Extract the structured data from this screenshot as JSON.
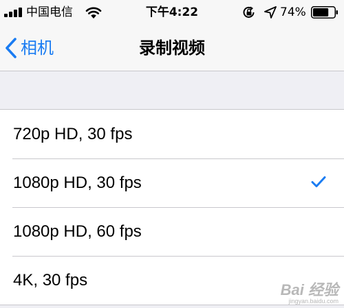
{
  "status_bar": {
    "carrier": "中国电信",
    "time": "下午4:22",
    "battery_percent": "74%",
    "battery_level": 0.74,
    "icons": [
      "signal-bars-icon",
      "wifi-icon",
      "rotation-lock-icon",
      "location-arrow-icon",
      "battery-icon"
    ]
  },
  "nav": {
    "back_label": "相机",
    "title": "录制视频"
  },
  "options": [
    {
      "label": "720p HD, 30 fps",
      "selected": false
    },
    {
      "label": "1080p HD, 30 fps",
      "selected": true
    },
    {
      "label": "1080p HD, 60 fps",
      "selected": false
    },
    {
      "label": "4K, 30 fps",
      "selected": false
    }
  ],
  "watermark": {
    "brand": "Bai 经验",
    "url": "jingyan.baidu.com"
  },
  "colors": {
    "accent": "#1a7cf2",
    "background": "#efeff4",
    "separator": "#c8c7cc"
  }
}
